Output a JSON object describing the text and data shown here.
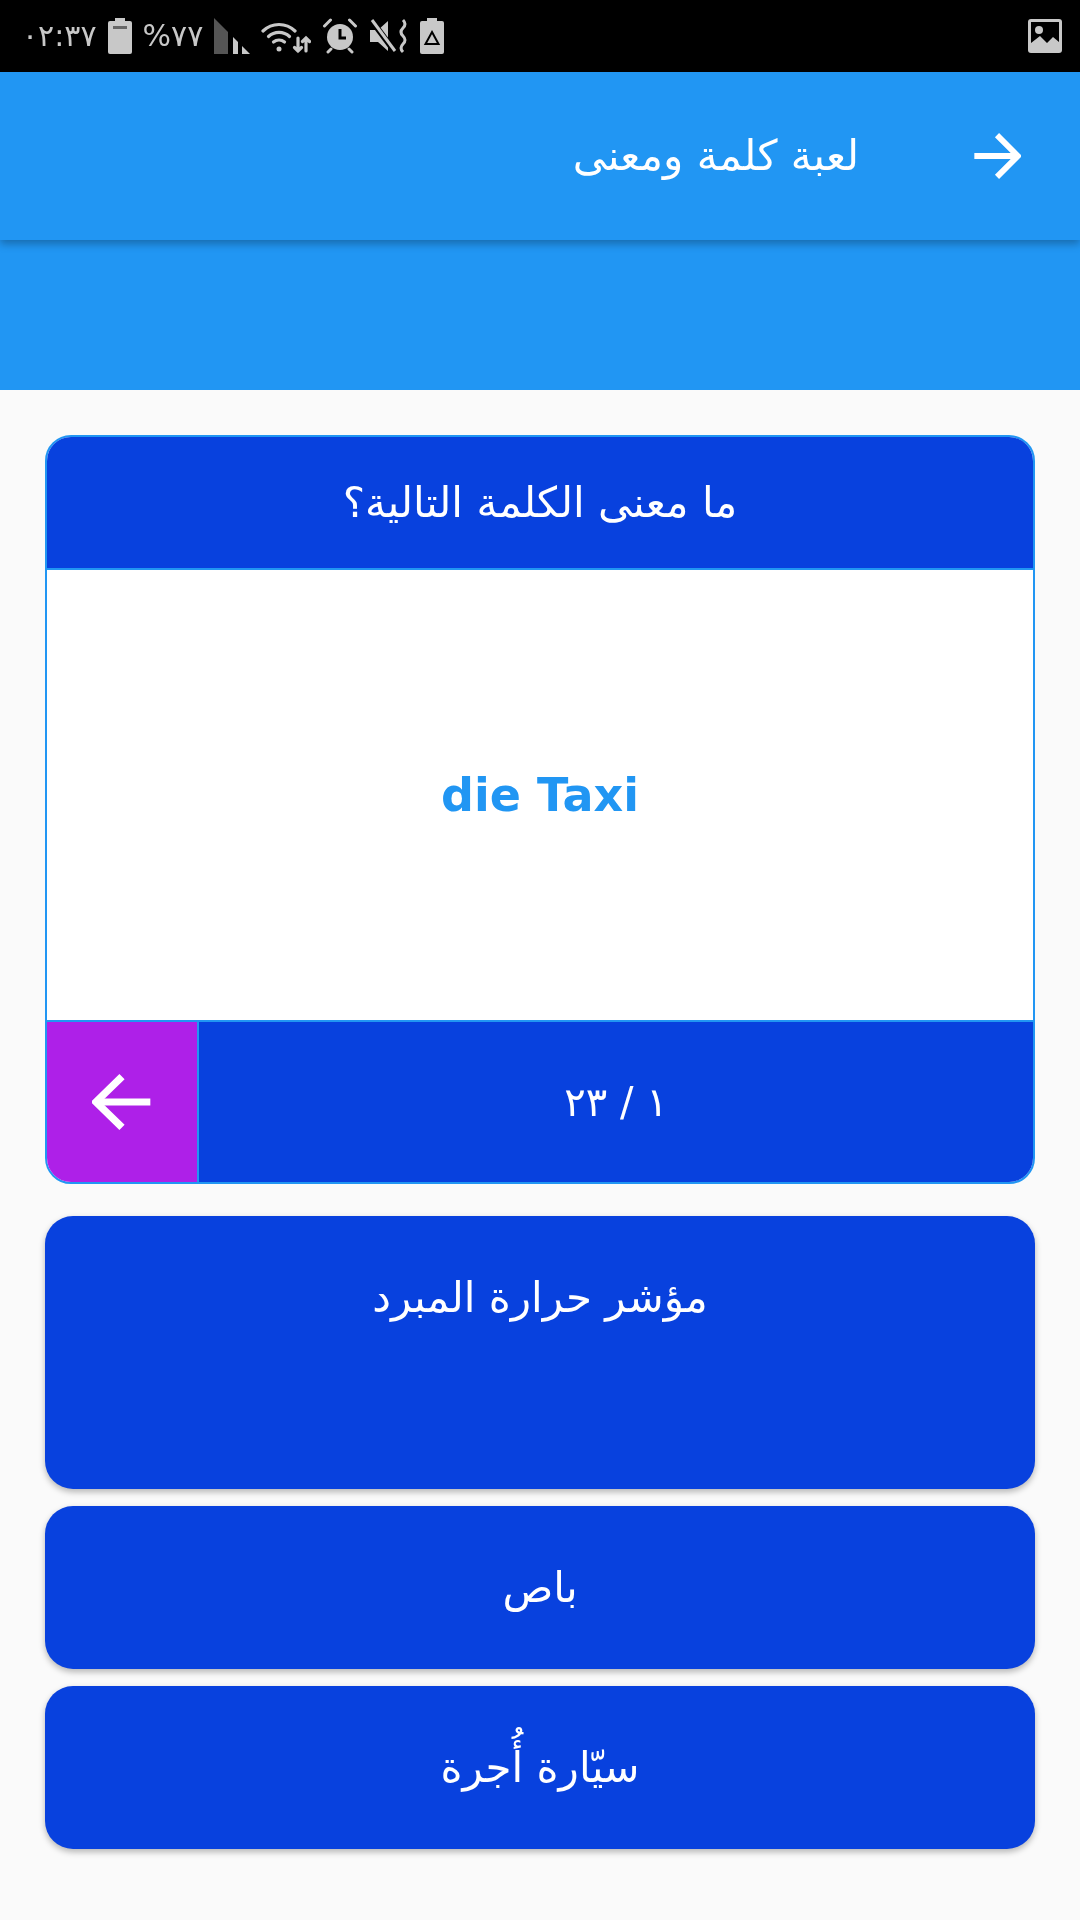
{
  "status_bar": {
    "time": "٠٢:٣٧",
    "battery": "%٧٧"
  },
  "app_bar": {
    "title": "لعبة كلمة ومعنى"
  },
  "question": {
    "prompt": "ما معنى الكلمة التالية؟",
    "word": "die Taxi",
    "counter": "١ / ٢٣"
  },
  "answers": [
    {
      "text": "مؤشر حرارة المبرد"
    },
    {
      "text": "باص"
    },
    {
      "text": "سيّارة أُجرة"
    }
  ]
}
